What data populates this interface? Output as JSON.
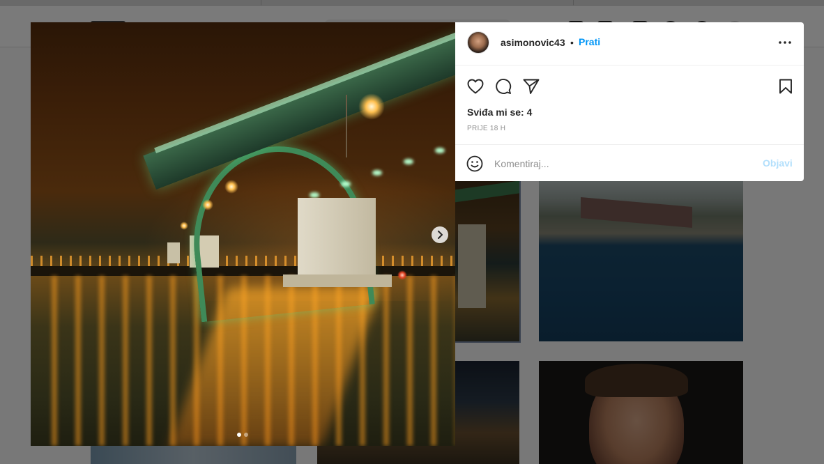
{
  "post": {
    "username": "asimonovic43",
    "separator": "•",
    "follow_label": "Prati",
    "likes_text": "Sviđa mi se: 4",
    "timestamp": "PRIJE 18 H",
    "comment_placeholder": "Komentiraj...",
    "post_button_label": "Objavi",
    "carousel": {
      "total": 2,
      "active": 1
    }
  },
  "icons": {
    "more": "more-horizontal-icon",
    "like": "heart-icon",
    "comment": "comment-icon",
    "share": "paper-plane-icon",
    "save": "bookmark-icon",
    "emoji": "smiley-icon",
    "next": "chevron-right-icon"
  },
  "colors": {
    "accent": "#0095f6",
    "post_button_disabled": "#b2dffc",
    "text_primary": "#262626",
    "text_secondary": "#8e8e8e"
  }
}
